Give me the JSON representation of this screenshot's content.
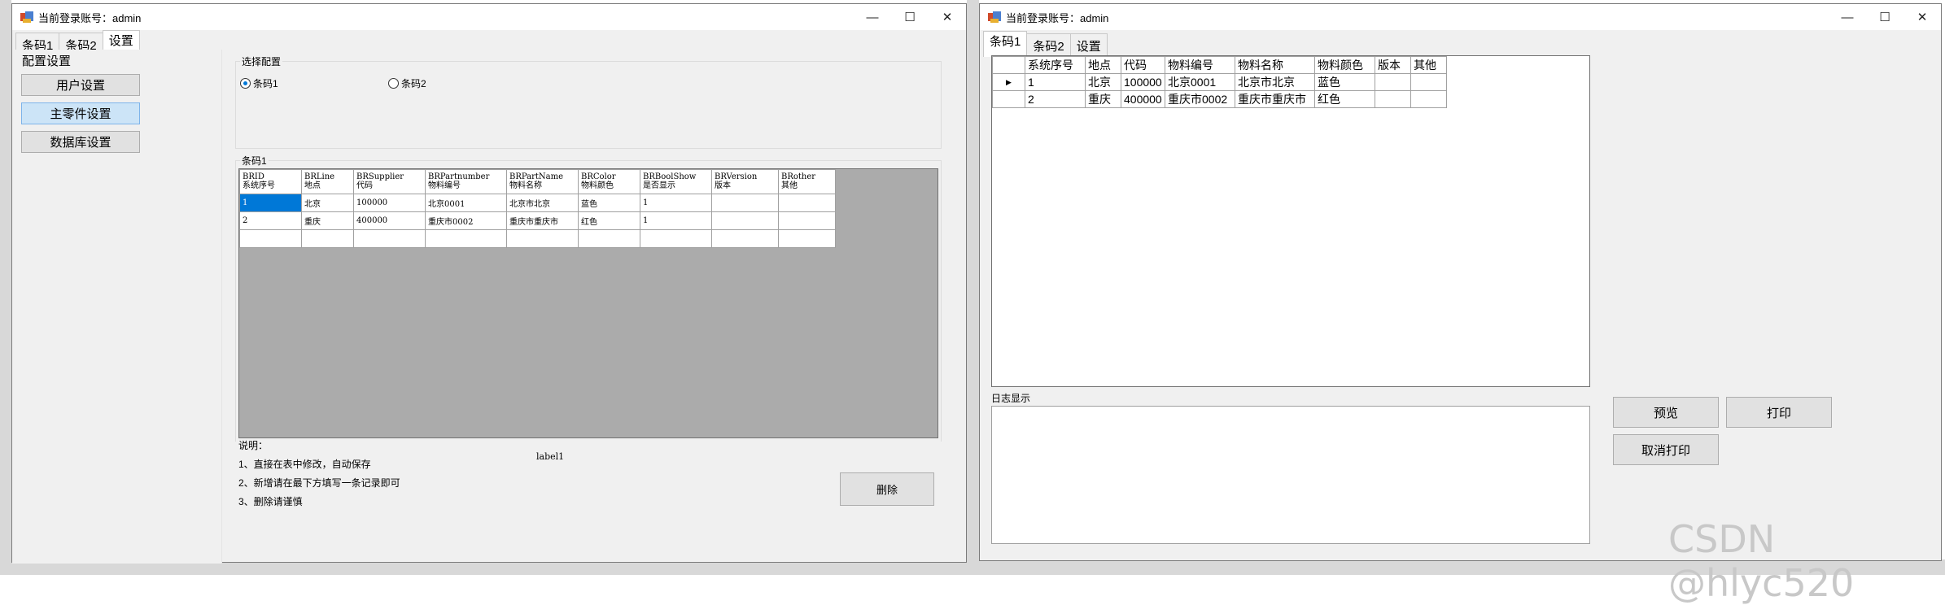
{
  "window1": {
    "title": "当前登录账号：admin",
    "tabs": [
      "条码1",
      "条码2",
      "设置"
    ],
    "config_title": "配置设置",
    "buttons": [
      "用户设置",
      "主零件设置",
      "数据库设置"
    ],
    "select_group": "选择配置",
    "radios": [
      {
        "label": "条码1",
        "checked": true
      },
      {
        "label": "条码2",
        "checked": false
      }
    ],
    "grid_group": "条码1",
    "columns": [
      {
        "name": "BRID",
        "sub": "系统序号"
      },
      {
        "name": "BRLine",
        "sub": "地点"
      },
      {
        "name": "BRSupplier",
        "sub": "代码"
      },
      {
        "name": "BRPartnumber",
        "sub": "物料编号"
      },
      {
        "name": "BRPartName",
        "sub": "物料名称"
      },
      {
        "name": "BRColor",
        "sub": "物料颜色"
      },
      {
        "name": "BRBoolShow",
        "sub": "是否显示"
      },
      {
        "name": "BRVersion",
        "sub": "版本"
      },
      {
        "name": "BRother",
        "sub": "其他"
      }
    ],
    "rows": [
      [
        "1",
        "北京",
        "100000",
        "北京0001",
        "北京市北京",
        "蓝色",
        "1",
        "",
        ""
      ],
      [
        "2",
        "重庆",
        "400000",
        "重庆市0002",
        "重庆市重庆市",
        "红色",
        "1",
        "",
        ""
      ],
      [
        "",
        "",
        "",
        "",
        "",
        "",
        "",
        "",
        ""
      ]
    ],
    "notes_title": "说明：",
    "notes": [
      "1、直接在表中修改，自动保存",
      "2、新增请在最下方填写一条记录即可",
      "3、删除请谨慎"
    ],
    "label1": "label1",
    "delete_button": "删除"
  },
  "window2": {
    "title": "当前登录账号：admin",
    "tabs": [
      "条码1",
      "条码2",
      "设置"
    ],
    "columns": [
      "系统序号",
      "地点",
      "代码",
      "物料编号",
      "物料名称",
      "物料颜色",
      "版本",
      "其他"
    ],
    "rows": [
      [
        "1",
        "北京",
        "100000",
        "北京0001",
        "北京市北京",
        "蓝色",
        "",
        ""
      ],
      [
        "2",
        "重庆",
        "400000",
        "重庆市0002",
        "重庆市重庆市",
        "红色",
        "",
        ""
      ]
    ],
    "log_label": "日志显示",
    "buttons": {
      "preview": "预览",
      "print": "打印",
      "cancel_print": "取消打印"
    }
  },
  "watermark": "CSDN @hlyc520",
  "colors": {
    "selection": "#0078d7",
    "button_selected": "#cce4f7",
    "grid_background": "#ababab"
  }
}
